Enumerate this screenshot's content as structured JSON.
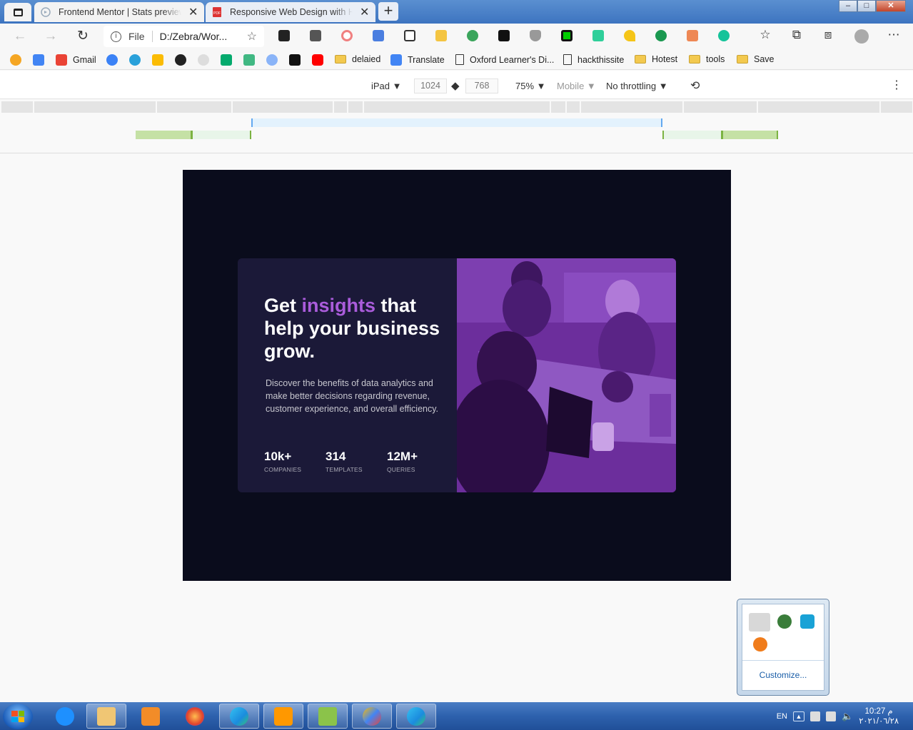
{
  "browser": {
    "tabs": [
      {
        "title": "Frontend Mentor | Stats preview card",
        "active": true
      },
      {
        "title": "Responsive Web Design with HTML",
        "active": false
      }
    ],
    "new_tab": "+",
    "address": {
      "scheme": "File",
      "url": "D:/Zebra/Wor..."
    },
    "window_controls": {
      "minimize": "–",
      "maximize": "□",
      "close": "✕"
    }
  },
  "bookmarks": [
    {
      "label": "Gmail"
    },
    {
      "label": "delaied"
    },
    {
      "label": "Translate"
    },
    {
      "label": "Oxford Learner's Di..."
    },
    {
      "label": "hackthissite"
    },
    {
      "label": "Hotest"
    },
    {
      "label": "tools"
    },
    {
      "label": "Save"
    }
  ],
  "device_toolbar": {
    "device": "iPad ▼",
    "width": "1024",
    "height": "768",
    "zoom": "75% ▼",
    "device_type": "Mobile ▼",
    "throttling": "No throttling ▼",
    "more": "⋮"
  },
  "page": {
    "heading_pre": "Get ",
    "heading_accent": "insights",
    "heading_post": " that help your business grow.",
    "description": "Discover the benefits of data analytics and make better decisions regarding revenue, customer experience, and overall efficiency.",
    "stats": [
      {
        "value": "10k+",
        "label": "COMPANIES"
      },
      {
        "value": "314",
        "label": "TEMPLATES"
      },
      {
        "value": "12M+",
        "label": "QUERIES"
      }
    ],
    "colors": {
      "background": "#0a0c1c",
      "card": "#1b1938",
      "accent": "#aa5cdb",
      "image_tint": "#6c2e9c"
    }
  },
  "tray_popup": {
    "customize": "Customize..."
  },
  "taskbar": {
    "language": "EN",
    "time": "10:27 م",
    "date": "٢٠٢١/٠٦/٢٨"
  }
}
